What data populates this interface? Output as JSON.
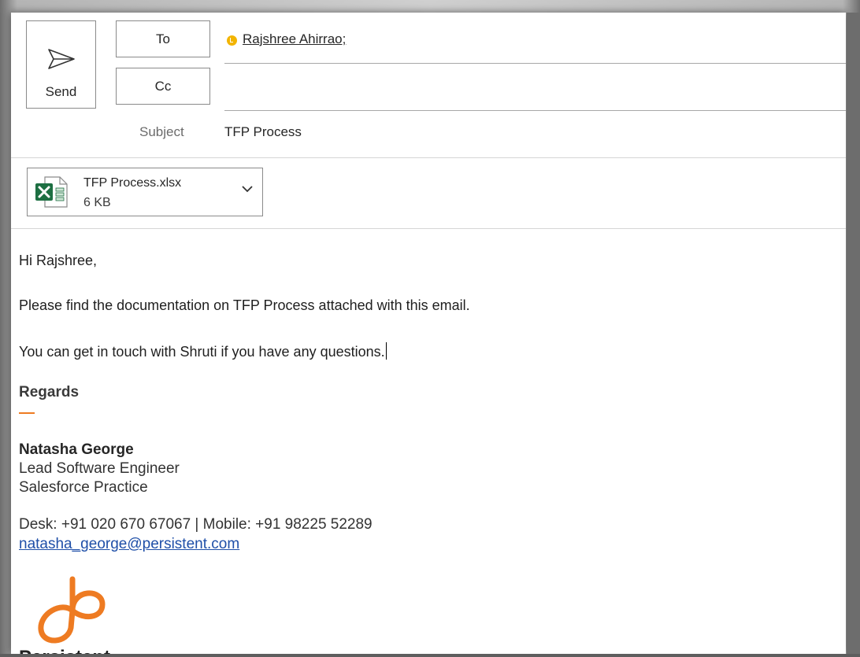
{
  "compose": {
    "send_label": "Send",
    "to_label": "To",
    "cc_label": "Cc",
    "recipient": "Rajshree Ahirrao;",
    "cc_value": "",
    "subject_label": "Subject",
    "subject_value": "TFP Process"
  },
  "attachment": {
    "name": "TFP Process.xlsx",
    "size": "6 KB",
    "icon": "excel-icon"
  },
  "body": {
    "greeting": "Hi Rajshree,",
    "para1": "Please find the documentation on TFP Process attached with this email.",
    "para2": "You can get in touch with Shruti if you have any questions."
  },
  "signature": {
    "regards": "Regards",
    "name": "Natasha George",
    "title": "Lead Software Engineer",
    "department": "Salesforce Practice",
    "phone": "Desk: +91 020 670 67067 | Mobile: +91 98225 52289",
    "email": "natasha_george@persistent.com",
    "logo_text": "Persistent"
  },
  "colors": {
    "accent_orange": "#ee7b22",
    "excel_green": "#1d6f42",
    "link_blue": "#1f4fa8",
    "recipient_status": "#f2b400"
  }
}
